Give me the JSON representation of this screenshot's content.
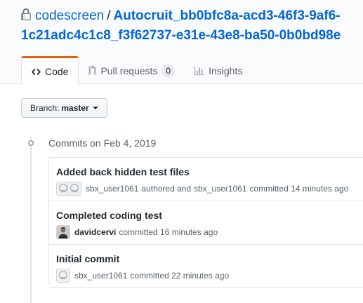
{
  "repo": {
    "owner": "codescreen",
    "separator": "/",
    "name_line1": "Autocruit_bb0bfc8a-acd3-46f3-9af6-",
    "name_line2": "1c21adc4c1c8_f3f62737-e31e-43e8-ba50-0b0bd98e"
  },
  "tabs": [
    {
      "label": "Code",
      "icon": "code-icon",
      "selected": true
    },
    {
      "label": "Pull requests",
      "icon": "pull-request-icon",
      "count": "0"
    },
    {
      "label": "Insights",
      "icon": "graph-icon"
    }
  ],
  "branch": {
    "prefix": "Branch:",
    "name": "master"
  },
  "timeline": {
    "date_heading": "Commits on Feb 4, 2019"
  },
  "commits": [
    {
      "message": "Added back hidden test files",
      "author": "sbx_user1061",
      "authored_text": "authored and",
      "committer": "sbx_user1061",
      "committed_text": "committed 14 minutes ago"
    },
    {
      "message": "Completed coding test",
      "author": "davidcervi",
      "committed_text": "committed 16 minutes ago"
    },
    {
      "message": "Initial commit",
      "author": "sbx_user1061",
      "committed_text": "committed 22 minutes ago"
    }
  ],
  "colors": {
    "link": "#0366d6",
    "tab_accent": "#e36209",
    "muted": "#586069",
    "border": "#e1e4e8"
  }
}
